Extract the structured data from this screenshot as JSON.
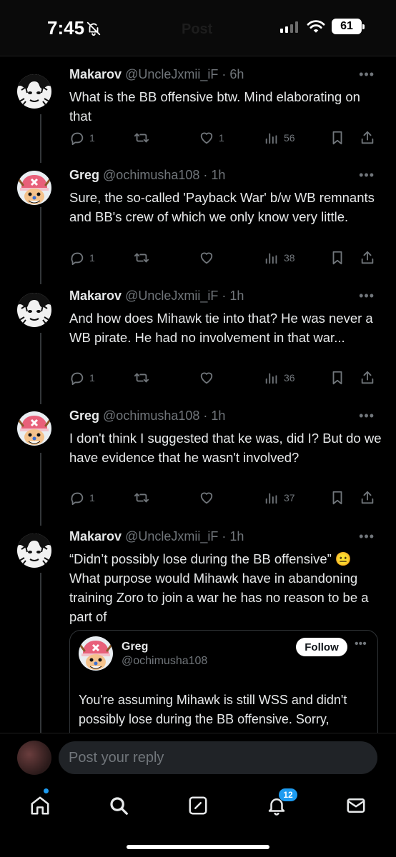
{
  "status_bar": {
    "time": "7:45",
    "battery": "61",
    "faded_title": "Post"
  },
  "tweets": [
    {
      "name": "Makarov",
      "handle": "@UncleJxmii_iF",
      "time": "6h",
      "text": "What is the BB offensive btw. Mind elaborating on that",
      "replies": "1",
      "retweets": "",
      "likes": "1",
      "views": "56",
      "avatar_icon": "manga-portrait-avatar"
    },
    {
      "name": "Greg",
      "handle": "@ochimusha108",
      "time": "1h",
      "text": "Sure, the so-called 'Payback War' b/w WB remnants and BB's crew of which we only know very little.",
      "replies": "1",
      "retweets": "",
      "likes": "",
      "views": "38",
      "avatar_icon": "chopper-avatar"
    },
    {
      "name": "Makarov",
      "handle": "@UncleJxmii_iF",
      "time": "1h",
      "text": "And how does Mihawk tie into that? He was never a WB pirate. He had no involvement in that war...",
      "replies": "1",
      "retweets": "",
      "likes": "",
      "views": "36",
      "avatar_icon": "manga-portrait-avatar"
    },
    {
      "name": "Greg",
      "handle": "@ochimusha108",
      "time": "1h",
      "text": "I don't think I suggested that ke was, did I? But do we have evidence that he wasn't involved?",
      "replies": "1",
      "retweets": "",
      "likes": "",
      "views": "37",
      "avatar_icon": "chopper-avatar"
    },
    {
      "name": "Makarov",
      "handle": "@UncleJxmii_iF",
      "time": "1h",
      "text": "“Didn’t possibly lose during the BB offensive” 😐 What purpose would Mihawk have in abandoning training Zoro to join a war he has no reason to be a part of",
      "avatar_icon": "manga-portrait-avatar"
    }
  ],
  "quoted": {
    "name": "Greg",
    "handle": "@ochimusha108",
    "follow_label": "Follow",
    "text": "You're assuming Mihawk is still WSS and didn't possibly lose during the BB offensive. Sorry,"
  },
  "reply": {
    "placeholder": "Post your reply"
  },
  "tabs": {
    "items": [
      "home-icon",
      "search-icon",
      "compose-icon",
      "notifications-icon",
      "messages-icon"
    ],
    "notif_count": "12"
  },
  "colors": {
    "accent": "#1d9bf0",
    "background": "#000000",
    "muted": "#71767b",
    "text": "#e7e9ea"
  }
}
